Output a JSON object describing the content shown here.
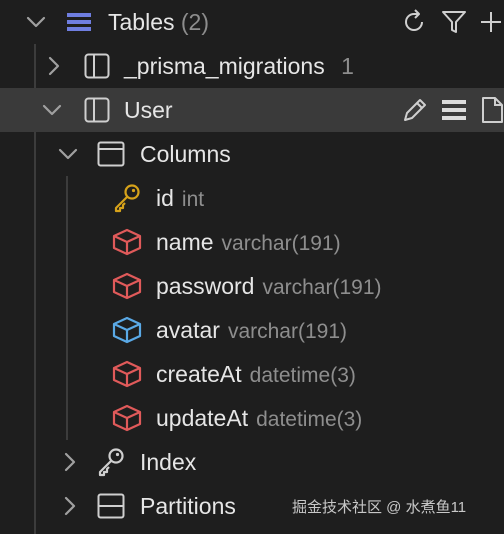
{
  "tree": {
    "tables": {
      "label": "Tables",
      "count": "(2)"
    },
    "prisma_migrations": {
      "label": "_prisma_migrations",
      "count": "1"
    },
    "user": {
      "label": "User"
    },
    "columns": {
      "label": "Columns"
    },
    "column_items": [
      {
        "name": "id",
        "type": "int",
        "icon": "key-icon",
        "color": "#d6a21a"
      },
      {
        "name": "name",
        "type": "varchar(191)",
        "icon": "cube-icon",
        "color": "#e05a5a"
      },
      {
        "name": "password",
        "type": "varchar(191)",
        "icon": "cube-icon",
        "color": "#e05a5a"
      },
      {
        "name": "avatar",
        "type": "varchar(191)",
        "icon": "cube-icon",
        "color": "#5aa9e6"
      },
      {
        "name": "createAt",
        "type": "datetime(3)",
        "icon": "cube-icon",
        "color": "#e05a5a"
      },
      {
        "name": "updateAt",
        "type": "datetime(3)",
        "icon": "cube-icon",
        "color": "#e05a5a"
      }
    ],
    "index": {
      "label": "Index"
    },
    "partitions": {
      "label": "Partitions"
    }
  },
  "watermark": "掘金技术社区 @ 水煮鱼11"
}
